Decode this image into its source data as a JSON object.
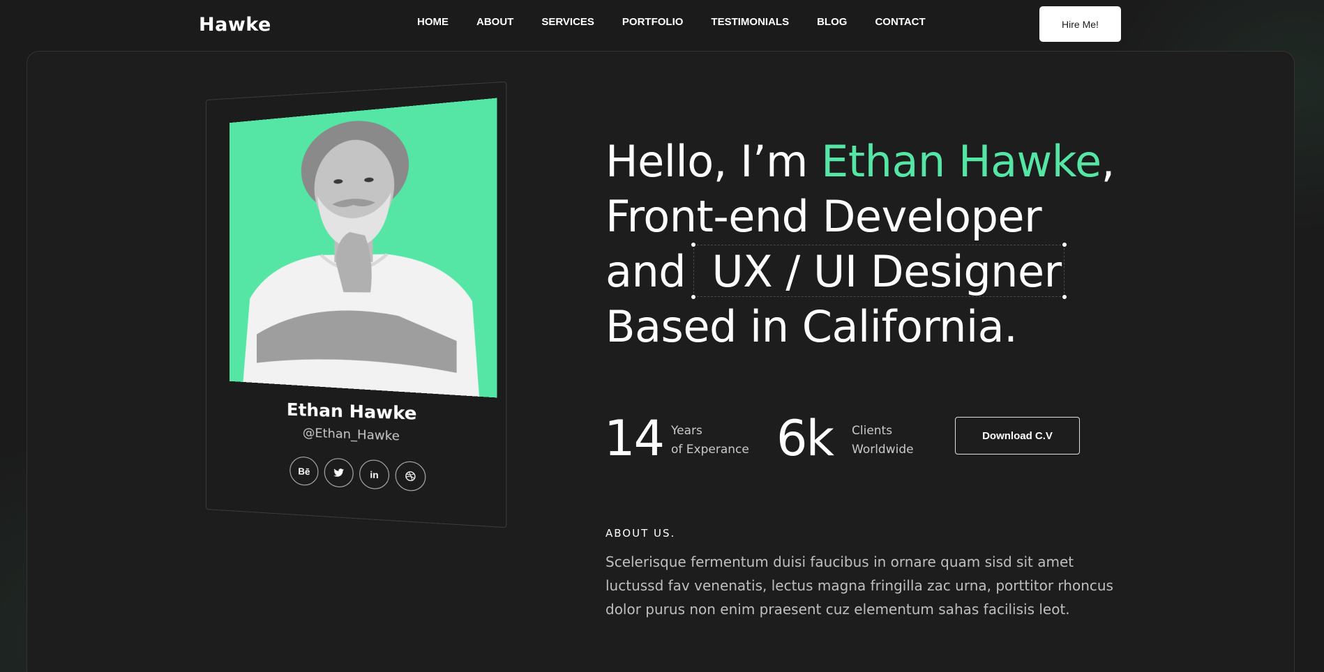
{
  "brand": {
    "logo": "Hawke"
  },
  "nav": {
    "items": [
      "HOME",
      "ABOUT",
      "SERVICES",
      "PORTFOLIO",
      "TESTIMONIALS",
      "BLOG",
      "CONTACT"
    ],
    "hire_label": "Hire Me!"
  },
  "profile": {
    "name": "Ethan Hawke",
    "handle": "@Ethan_Hawke",
    "socials": [
      {
        "icon": "behance-icon",
        "glyph": "Bē"
      },
      {
        "icon": "twitter-icon",
        "glyph": "🐦"
      },
      {
        "icon": "linkedin-icon",
        "glyph": "in"
      },
      {
        "icon": "dribbble-icon",
        "glyph": "◎"
      }
    ],
    "photo_bg": "#55e6a5"
  },
  "hero": {
    "line1_pre": "Hello, I’m ",
    "line1_name": "Ethan Hawke",
    "line1_post": ",",
    "line2": "Front-end Developer",
    "line3_pre": "and",
    "line3_boxed": "UX / UI Designer",
    "line4": "Based in California."
  },
  "stats": [
    {
      "value": "14",
      "label1": "Years",
      "label2": "of Experance"
    },
    {
      "value": "6k",
      "label1": "Clients",
      "label2": "Worldwide"
    }
  ],
  "cv_label": "Download C.V",
  "about": {
    "title": "ABOUT US.",
    "text": "Scelerisque fermentum duisi faucibus in ornare quam sisd sit amet luctussd fav venenatis, lectus magna fringilla zac urna, porttitor rhoncus dolor purus non enim praesent cuz elementum sahas facilisis leot."
  },
  "colors": {
    "accent": "#55e6a5",
    "background": "#1b1b1b"
  }
}
